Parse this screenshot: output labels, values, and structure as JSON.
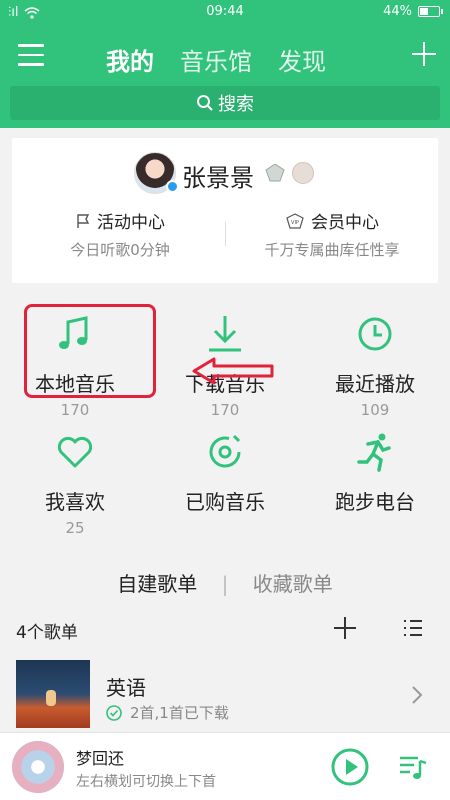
{
  "theme": {
    "accent": "#31c27c",
    "highlight": "#e0233b"
  },
  "status_bar": {
    "signal": "⫶ıl",
    "time": "09:44",
    "battery": "44%"
  },
  "header": {
    "tabs": [
      {
        "label": "我的",
        "active": true
      },
      {
        "label": "音乐馆",
        "active": false
      },
      {
        "label": "发现",
        "active": false
      }
    ],
    "search_label": "搜索"
  },
  "profile": {
    "name": "张景景",
    "activity": {
      "title": "活动中心",
      "desc": "今日听歌0分钟"
    },
    "vip": {
      "title": "会员中心",
      "desc": "千万专属曲库任性享"
    }
  },
  "grid": [
    {
      "label": "本地音乐",
      "count": "170",
      "icon": "music-note-icon"
    },
    {
      "label": "下载音乐",
      "count": "170",
      "icon": "download-icon"
    },
    {
      "label": "最近播放",
      "count": "109",
      "icon": "clock-icon"
    },
    {
      "label": "我喜欢",
      "count": "25",
      "icon": "heart-icon"
    },
    {
      "label": "已购音乐",
      "count": "",
      "icon": "purchased-disc-icon"
    },
    {
      "label": "跑步电台",
      "count": "",
      "icon": "runner-icon"
    }
  ],
  "playlists": {
    "tab_created": "自建歌单",
    "tab_separator": "|",
    "tab_favorited": "收藏歌单",
    "count_label": "4个歌单",
    "items": [
      {
        "name": "英语",
        "meta": "2首,1首已下载"
      }
    ]
  },
  "player": {
    "title": "梦回还",
    "subtitle": "左右横划可切换上下首"
  }
}
